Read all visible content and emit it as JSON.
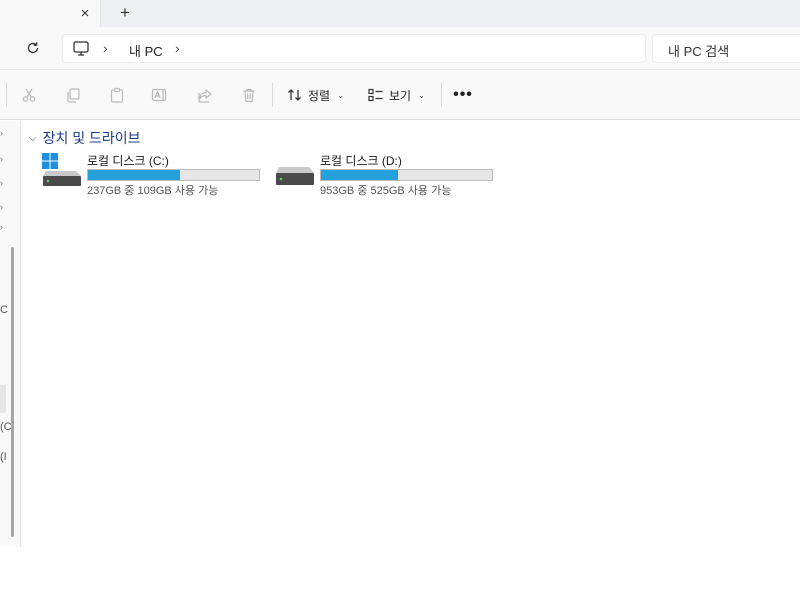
{
  "tabs": {
    "close_glyph": "×",
    "new_tab_glyph": "+"
  },
  "address": {
    "breadcrumb": "내 PC",
    "separator": "›",
    "search_placeholder": "내 PC 검색"
  },
  "commandbar": {
    "sort_label": "정렬",
    "view_label": "보기",
    "more_label": "•••",
    "caret": "⌄"
  },
  "content": {
    "group_title": "장치 및 드라이브",
    "group_chevron": "⌵",
    "drives": [
      {
        "name": "로컬 디스크 (C:)",
        "space": "237GB 중 109GB 사용 가능",
        "used_fraction": 0.54,
        "icon": "windows-drive-icon"
      },
      {
        "name": "로컬 디스크 (D:)",
        "space": "953GB 중 525GB 사용 가능",
        "used_fraction": 0.45,
        "icon": "hard-drive-icon"
      }
    ]
  },
  "nav": {
    "fragments": [
      "C",
      "(C",
      "(I"
    ]
  },
  "colors": {
    "accent": "#26a0da",
    "group_title": "#1a3a8a",
    "win_blue": "#1e90e0"
  }
}
